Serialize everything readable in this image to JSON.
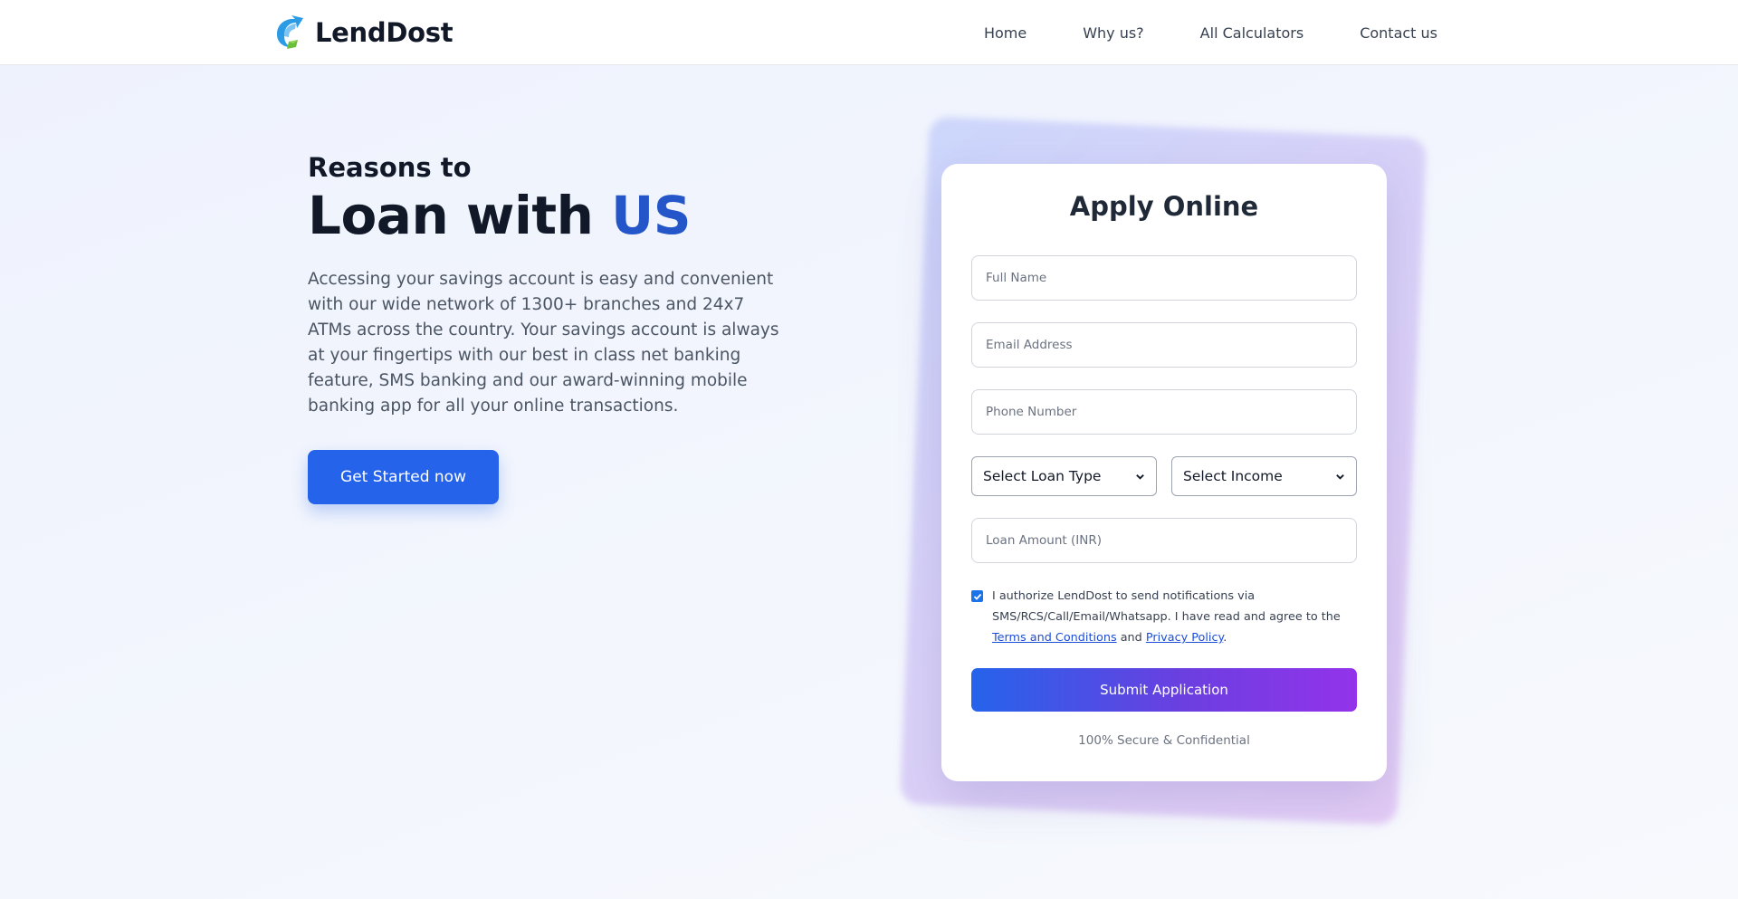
{
  "brand": {
    "name": "LendDost",
    "logo_icon": "arrow-leaf-icon"
  },
  "nav": [
    {
      "label": "Home"
    },
    {
      "label": "Why us?"
    },
    {
      "label": "All Calculators"
    },
    {
      "label": "Contact us"
    }
  ],
  "hero": {
    "kicker": "Reasons to",
    "title_main": "Loan with",
    "title_accent": "US",
    "description": "Accessing your savings account is easy and convenient with our wide network of 1300+ branches and 24x7 ATMs across the country. Your savings account is always at your fingertips with our best in class net banking feature, SMS banking and our award-winning mobile banking app for all your online transactions.",
    "cta_label": "Get Started now"
  },
  "form": {
    "title": "Apply Online",
    "full_name_placeholder": "Full Name",
    "email_placeholder": "Email Address",
    "phone_placeholder": "Phone Number",
    "loan_type_selected": "Select Loan Type",
    "income_selected": "Select Income",
    "loan_amount_placeholder": "Loan Amount (INR)",
    "consent_checked": true,
    "consent_text_before": "I authorize LendDost to send notifications via SMS/RCS/Call/Email/Whatsapp. I have read and agree to the",
    "terms_link": "Terms and Conditions",
    "consent_and": "and",
    "privacy_link": "Privacy Policy",
    "consent_end": ".",
    "submit_label": "Submit Application",
    "secure_note": "100% Secure & Confidential"
  },
  "colors": {
    "accent": "#2563eb",
    "title_accent": "#2456c9",
    "gradient_end": "#9333ea"
  }
}
